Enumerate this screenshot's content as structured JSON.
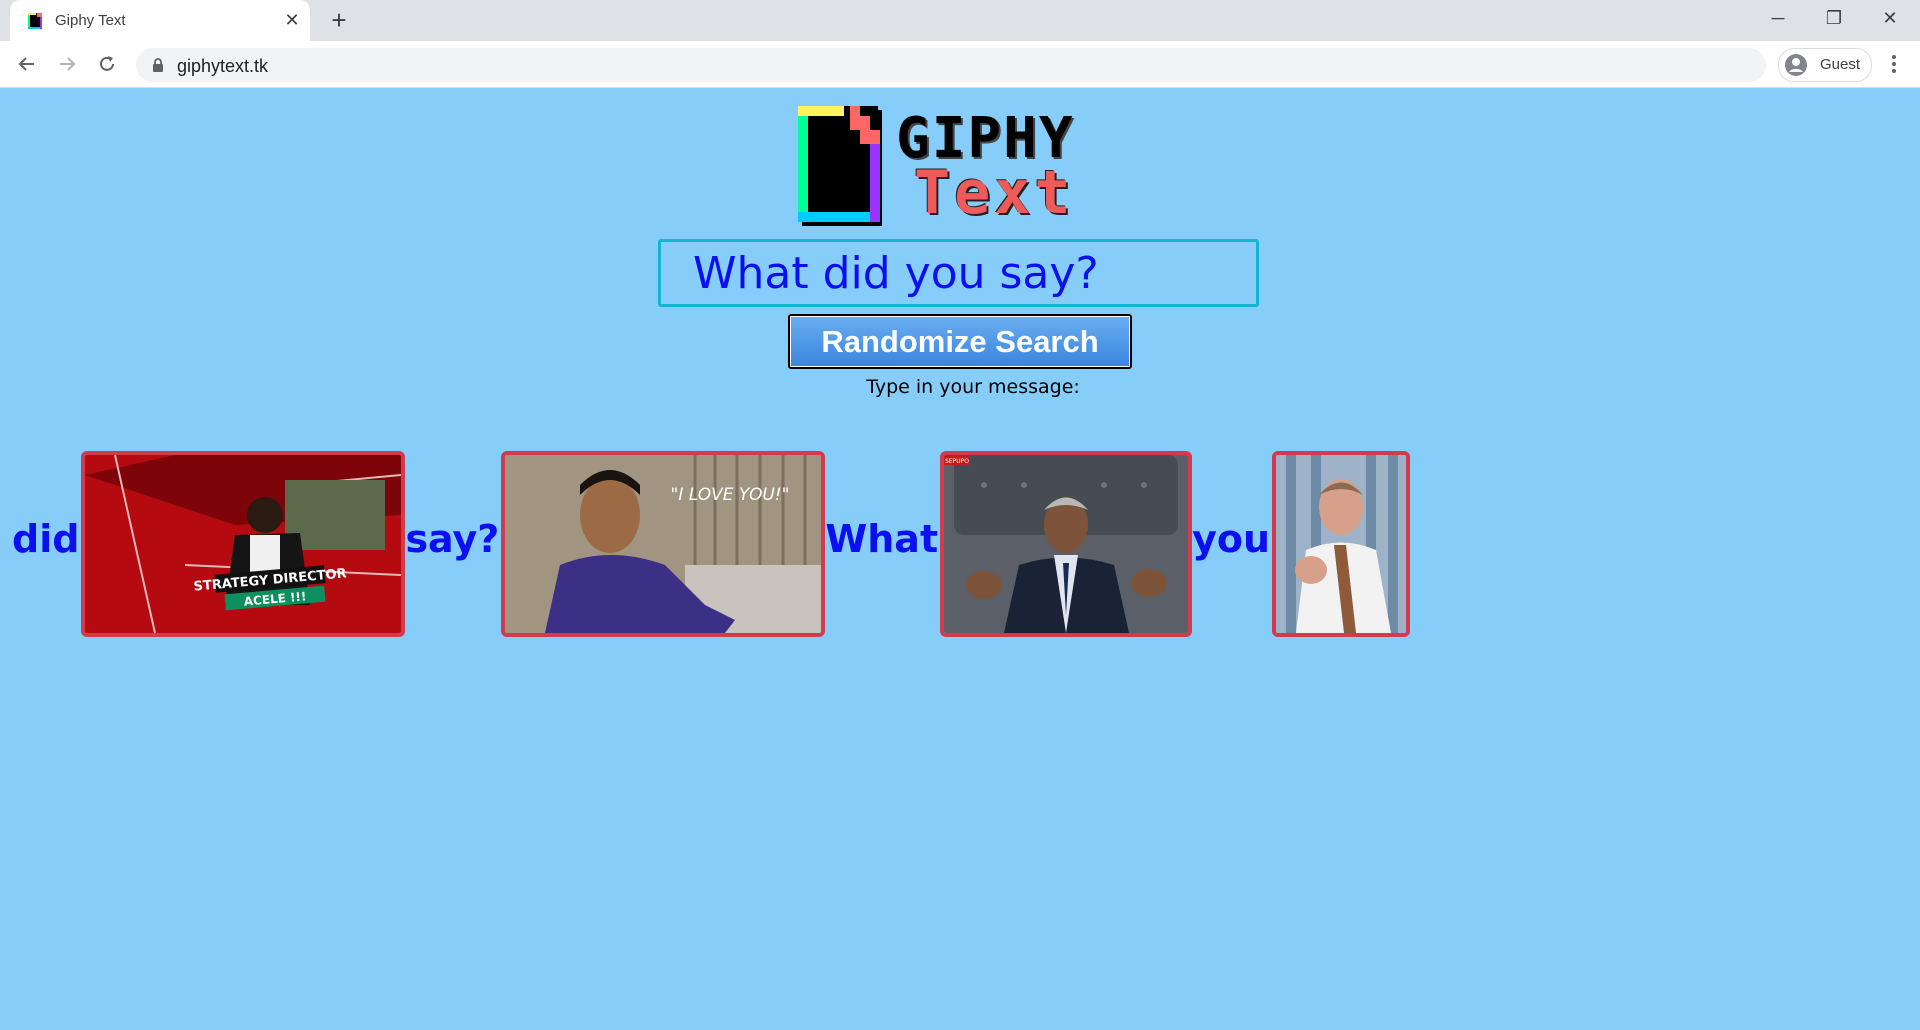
{
  "browser": {
    "tab_title": "Giphy Text",
    "tab_close": "✕",
    "new_tab": "+",
    "url": "giphytext.tk",
    "profile_label": "Guest",
    "window_controls": {
      "minimize": "─",
      "restore": "❐",
      "close": "✕"
    }
  },
  "page": {
    "logo_word_1": "GIPHY",
    "logo_word_2": "Text",
    "search_placeholder": "What did you say?",
    "randomize_button": "Randomize Search",
    "instruction": "Type in your message:",
    "results": [
      {
        "word": "did",
        "gif_caption": "STRATEGY DIRECTOR",
        "gif_caption_2": "ACELE !!!"
      },
      {
        "word": "say?",
        "gif_caption": "\"I LOVE YOU!\""
      },
      {
        "word": "What",
        "gif_caption": "SEPUPO"
      },
      {
        "word": "you"
      }
    ]
  },
  "colors": {
    "page_bg": "#87cdf9",
    "text_blue": "#0c0ff0",
    "input_border": "#13b5cf",
    "gif_border": "#d33a4c",
    "button_top": "#6aaef1",
    "button_bottom": "#3a84dd"
  },
  "icons": [
    "back-arrow-icon",
    "forward-arrow-icon",
    "reload-icon",
    "lock-icon",
    "profile-icon",
    "kebab-menu-icon",
    "giphy-favicon"
  ]
}
